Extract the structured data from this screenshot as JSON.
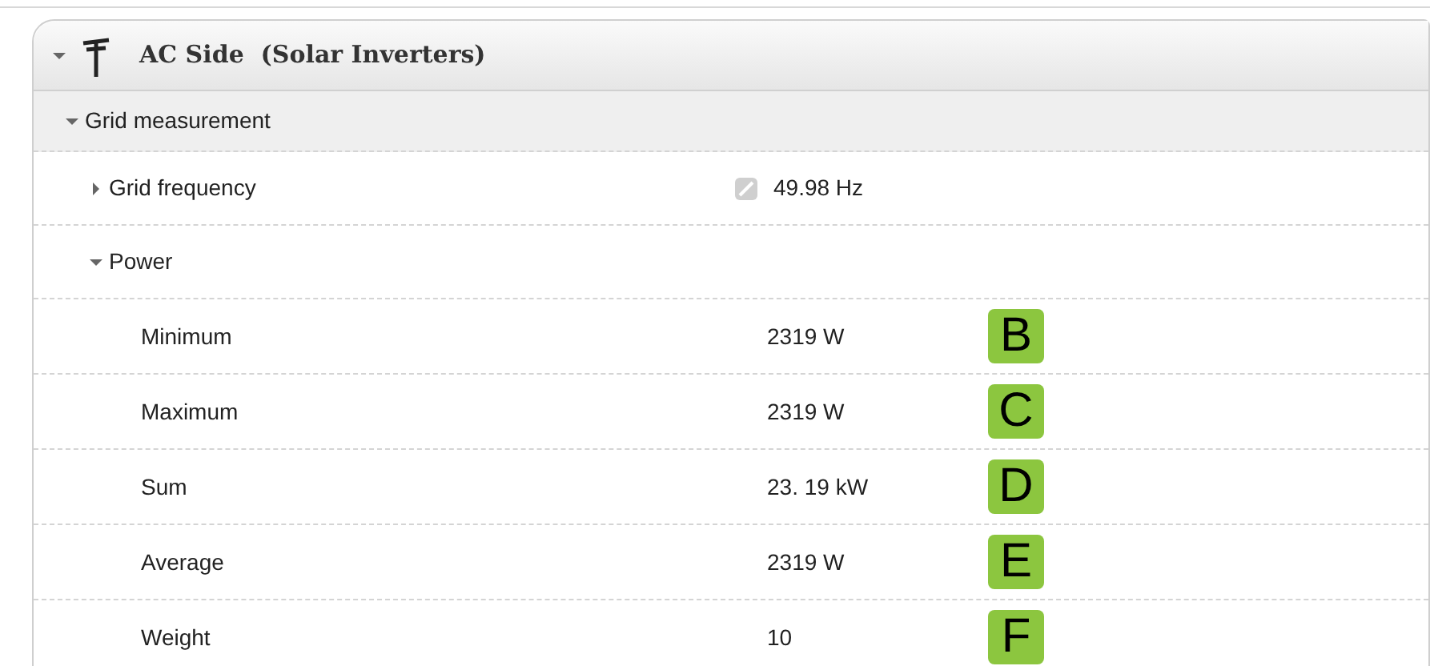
{
  "panel": {
    "title": "AC Side  (Solar Inverters)",
    "expanded": true
  },
  "group": {
    "label": "Grid measurement",
    "expanded": true,
    "items": [
      {
        "label": "Grid frequency",
        "expanded": false,
        "value": "49.98 Hz",
        "flag": true
      },
      {
        "label": "Power",
        "expanded": true,
        "children": [
          {
            "label": "Minimum",
            "value": "2319 W",
            "badge": "B"
          },
          {
            "label": "Maximum",
            "value": "2319 W",
            "badge": "C"
          },
          {
            "label": "Sum",
            "value": "23. 19 kW",
            "badge": "D"
          },
          {
            "label": "Average",
            "value": "2319 W",
            "badge": "E"
          },
          {
            "label": "Weight",
            "value": "10",
            "badge": "F"
          }
        ]
      }
    ]
  }
}
